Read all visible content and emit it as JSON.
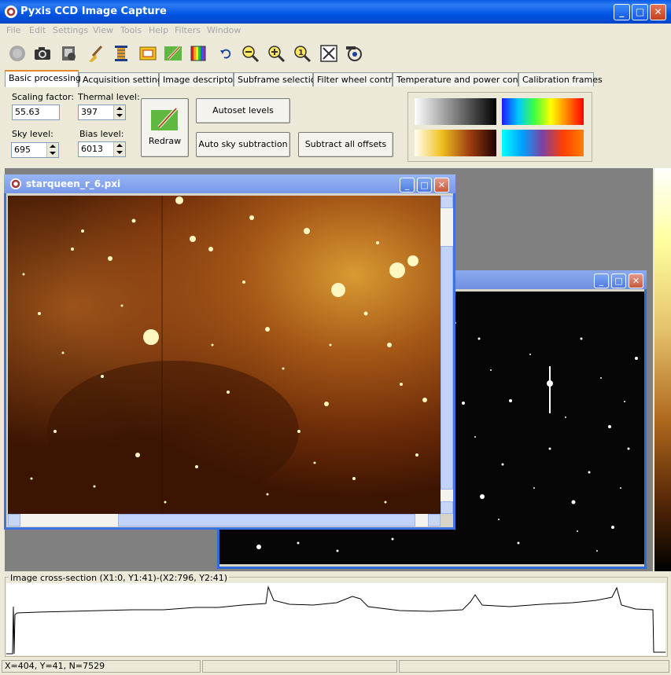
{
  "window": {
    "title": "Pyxis CCD Image Capture",
    "icon": "pyxis-app-icon",
    "controls": [
      "minimize-icon",
      "maximize-icon",
      "close-icon"
    ]
  },
  "menu": [
    "File",
    "Edit",
    "Settings",
    "View",
    "Tools",
    "Help",
    "Filters",
    "Window"
  ],
  "toolbar": [
    "disabled-record-icon",
    "camera-icon",
    "film-camera-icon",
    "broom-icon",
    "histogram-icon",
    "subframe-icon",
    "pencil-icon",
    "palette-icon",
    "undo-icon",
    "zoom-out-icon",
    "zoom-in-icon",
    "zoom-actual-size-icon",
    "fit-to-window-icon",
    "rotate-icon"
  ],
  "tabs": [
    "Basic processing",
    "Acquisition settings",
    "Image descriptors",
    "Subframe selection",
    "Filter wheel control",
    "Temperature and power control",
    "Calibration frames"
  ],
  "active_tab": "Basic processing",
  "basic": {
    "scaling_label": "Scaling factor:",
    "scaling_value": "55.63",
    "thermal_label": "Thermal level:",
    "thermal_value": "397",
    "sky_label": "Sky level:",
    "sky_value": "695",
    "bias_label": "Bias level:",
    "bias_value": "6013",
    "redraw": "Redraw",
    "autoset": "Autoset levels",
    "auto_sky": "Auto sky subtraction",
    "subtract": "Subtract all offsets"
  },
  "palettes": [
    "grayscale",
    "spectrum",
    "heat",
    "cool-warm"
  ],
  "image_window": {
    "title": "starqueen_r_6.pxi"
  },
  "cross_section": {
    "label": "Image cross-section (X1:0, Y1:41)-(X2:796, Y2:41)"
  },
  "status": {
    "coords": "X=404, Y=41, N=7529",
    "field2": "",
    "field3": ""
  }
}
